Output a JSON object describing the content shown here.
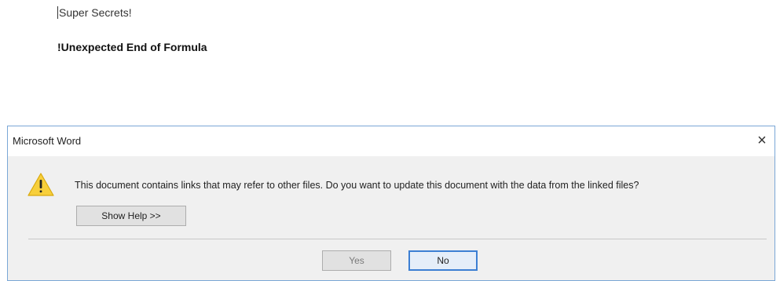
{
  "document": {
    "line1": "Super Secrets!",
    "line2": "!Unexpected End of Formula"
  },
  "dialog": {
    "title": "Microsoft Word",
    "close_glyph": "×",
    "icon": "warning-icon",
    "message": "This document contains links that may refer to other files. Do you want to update this document with the data from the linked files?",
    "show_help_label": "Show Help >>",
    "yes_label": "Yes",
    "no_label": "No",
    "accent_color": "#3c7fd3"
  }
}
